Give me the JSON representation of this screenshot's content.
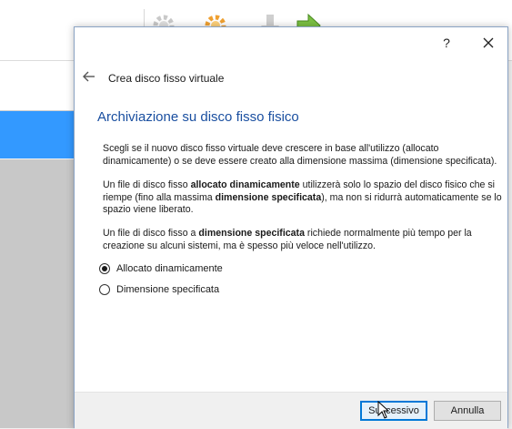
{
  "dialog": {
    "help_label": "?",
    "wizard_title": "Crea disco fisso virtuale",
    "page_title": "Archiviazione su disco fisso fisico",
    "paragraph1": "Scegli se il nuovo disco fisso virtuale deve crescere in base all'utilizzo (allocato dinamicamente) o se deve essere creato alla dimensione massima (dimensione specificata).",
    "paragraph2": {
      "t1": "Un file di disco fisso ",
      "b1": "allocato dinamicamente",
      "t2": " utilizzerà solo lo spazio del disco fisico che si riempe (fino alla massima ",
      "b2": "dimensione specificata",
      "t3": "), ma non si ridurrà automaticamente se lo spazio viene liberato."
    },
    "paragraph3": {
      "t1": "Un file di disco fisso a ",
      "b1": "dimensione specificata",
      "t2": " richiede normalmente più tempo per la creazione su alcuni sistemi, ma è spesso più veloce nell'utilizzo."
    },
    "options": [
      {
        "label": "Allocato dinamicamente",
        "selected": true
      },
      {
        "label": "Dimensione specificata",
        "selected": false
      }
    ],
    "buttons": {
      "next": "Successivo",
      "cancel": "Annulla"
    }
  },
  "colors": {
    "accent": "#0078d7",
    "title_blue": "#1a4fa0",
    "selection_blue": "#3399ff"
  },
  "icons": [
    "gear-icon",
    "gear-orange-icon",
    "discard-icon",
    "start-arrow-icon",
    "help-icon",
    "close-icon",
    "back-arrow-icon",
    "mouse-cursor-icon"
  ]
}
